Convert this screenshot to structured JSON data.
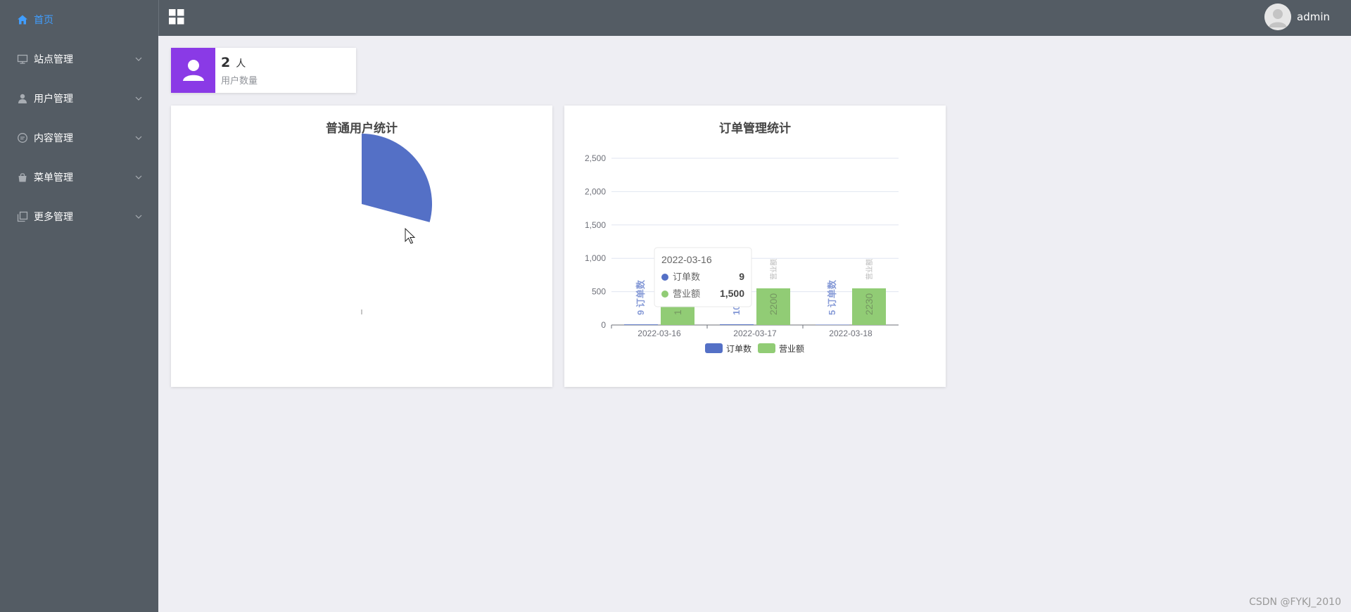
{
  "sidebar": {
    "items": [
      {
        "label": "首页",
        "icon": "home-icon",
        "active": true
      },
      {
        "label": "站点管理",
        "icon": "monitor-icon"
      },
      {
        "label": "用户管理",
        "icon": "user-icon"
      },
      {
        "label": "内容管理",
        "icon": "chat-icon"
      },
      {
        "label": "菜单管理",
        "icon": "bag-icon"
      },
      {
        "label": "更多管理",
        "icon": "copy-icon"
      }
    ]
  },
  "header": {
    "username": "admin"
  },
  "stat": {
    "value": "2",
    "unit": "人",
    "label": "用户数量"
  },
  "panels": {
    "pie_title": "普通用户统计",
    "bar_title": "订单管理统计"
  },
  "chart_data": [
    {
      "type": "pie",
      "title": "普通用户统计",
      "slices": [
        {
          "value": 1,
          "color": "#5470c6"
        }
      ],
      "start_angle_deg": 0,
      "end_angle_deg": 105
    },
    {
      "type": "bar",
      "title": "订单管理统计",
      "categories": [
        "2022-03-16",
        "2022-03-17",
        "2022-03-18"
      ],
      "ylim": [
        0,
        2500
      ],
      "yticks": [
        "0",
        "500",
        "1,000",
        "1,500",
        "2,000",
        "2,500"
      ],
      "series": [
        {
          "name": "订单数",
          "color": "#5470c6",
          "values": [
            9,
            10,
            5
          ],
          "labels": [
            "9 订单数",
            "10",
            "5 订单数"
          ]
        },
        {
          "name": "营业额",
          "color": "#91cc75",
          "values": [
            550,
            550,
            550
          ],
          "labels": [
            "1",
            "2200",
            "2230"
          ],
          "tag": "营业额"
        }
      ],
      "legend": "bottom",
      "grid": true,
      "tooltip": {
        "title": "2022-03-16",
        "rows": [
          {
            "name": "订单数",
            "value": "9",
            "color": "#5470c6"
          },
          {
            "name": "营业额",
            "value": "1,500",
            "color": "#91cc75"
          }
        ]
      }
    }
  ],
  "watermark": "CSDN @FYKJ_2010"
}
